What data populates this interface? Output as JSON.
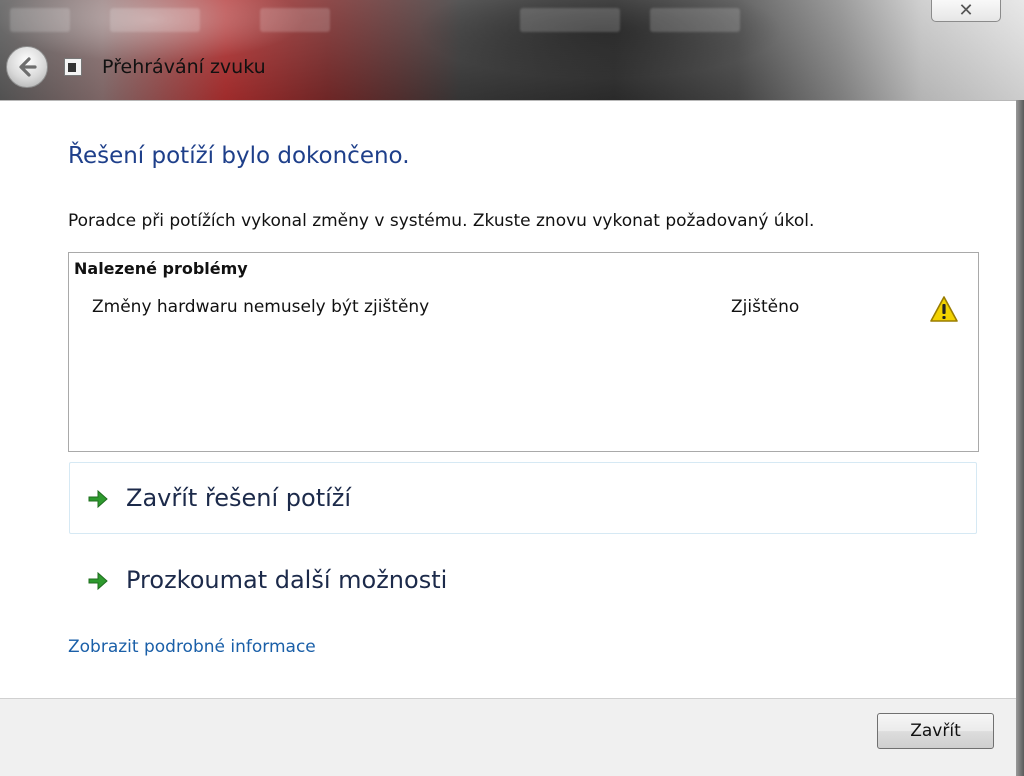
{
  "window": {
    "title": "Přehrávání zvuku",
    "close_glyph": "✕"
  },
  "content": {
    "heading": "Řešení potíží bylo dokončeno.",
    "intro": "Poradce při potížích vykonal změny v systému. Zkuste znovu vykonat požadovaný úkol."
  },
  "problems": {
    "header": "Nalezené problémy",
    "items": [
      {
        "text": "Změny hardwaru nemusely být zjištěny",
        "status": "Zjištěno",
        "icon": "warning-icon"
      }
    ]
  },
  "options": [
    {
      "label": "Zavřít řešení potíží",
      "icon": "green-arrow-icon"
    },
    {
      "label": "Prozkoumat další možnosti",
      "icon": "green-arrow-icon"
    }
  ],
  "details_link": "Zobrazit podrobné informace",
  "footer": {
    "close_label": "Zavřít"
  },
  "colors": {
    "heading": "#1e3f8a",
    "link": "#1a5fa8",
    "arrow": "#2e9a2e",
    "warning": "#f2d200"
  }
}
